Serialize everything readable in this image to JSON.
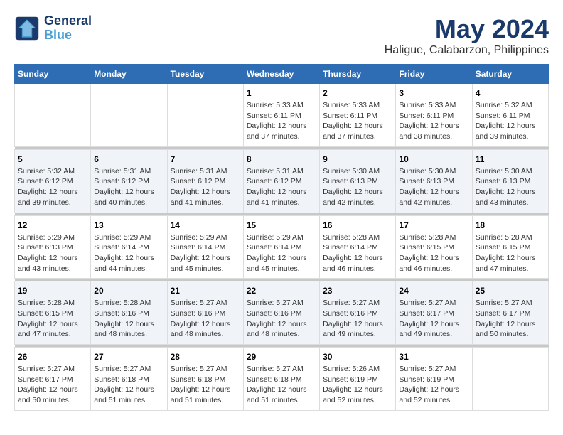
{
  "logo": {
    "line1": "General",
    "line2": "Blue"
  },
  "title": "May 2024",
  "subtitle": "Haligue, Calabarzon, Philippines",
  "headers": [
    "Sunday",
    "Monday",
    "Tuesday",
    "Wednesday",
    "Thursday",
    "Friday",
    "Saturday"
  ],
  "weeks": [
    {
      "days": [
        {
          "num": "",
          "info": ""
        },
        {
          "num": "",
          "info": ""
        },
        {
          "num": "",
          "info": ""
        },
        {
          "num": "1",
          "info": "Sunrise: 5:33 AM\nSunset: 6:11 PM\nDaylight: 12 hours\nand 37 minutes."
        },
        {
          "num": "2",
          "info": "Sunrise: 5:33 AM\nSunset: 6:11 PM\nDaylight: 12 hours\nand 37 minutes."
        },
        {
          "num": "3",
          "info": "Sunrise: 5:33 AM\nSunset: 6:11 PM\nDaylight: 12 hours\nand 38 minutes."
        },
        {
          "num": "4",
          "info": "Sunrise: 5:32 AM\nSunset: 6:11 PM\nDaylight: 12 hours\nand 39 minutes."
        }
      ]
    },
    {
      "days": [
        {
          "num": "5",
          "info": "Sunrise: 5:32 AM\nSunset: 6:12 PM\nDaylight: 12 hours\nand 39 minutes."
        },
        {
          "num": "6",
          "info": "Sunrise: 5:31 AM\nSunset: 6:12 PM\nDaylight: 12 hours\nand 40 minutes."
        },
        {
          "num": "7",
          "info": "Sunrise: 5:31 AM\nSunset: 6:12 PM\nDaylight: 12 hours\nand 41 minutes."
        },
        {
          "num": "8",
          "info": "Sunrise: 5:31 AM\nSunset: 6:12 PM\nDaylight: 12 hours\nand 41 minutes."
        },
        {
          "num": "9",
          "info": "Sunrise: 5:30 AM\nSunset: 6:13 PM\nDaylight: 12 hours\nand 42 minutes."
        },
        {
          "num": "10",
          "info": "Sunrise: 5:30 AM\nSunset: 6:13 PM\nDaylight: 12 hours\nand 42 minutes."
        },
        {
          "num": "11",
          "info": "Sunrise: 5:30 AM\nSunset: 6:13 PM\nDaylight: 12 hours\nand 43 minutes."
        }
      ]
    },
    {
      "days": [
        {
          "num": "12",
          "info": "Sunrise: 5:29 AM\nSunset: 6:13 PM\nDaylight: 12 hours\nand 43 minutes."
        },
        {
          "num": "13",
          "info": "Sunrise: 5:29 AM\nSunset: 6:14 PM\nDaylight: 12 hours\nand 44 minutes."
        },
        {
          "num": "14",
          "info": "Sunrise: 5:29 AM\nSunset: 6:14 PM\nDaylight: 12 hours\nand 45 minutes."
        },
        {
          "num": "15",
          "info": "Sunrise: 5:29 AM\nSunset: 6:14 PM\nDaylight: 12 hours\nand 45 minutes."
        },
        {
          "num": "16",
          "info": "Sunrise: 5:28 AM\nSunset: 6:14 PM\nDaylight: 12 hours\nand 46 minutes."
        },
        {
          "num": "17",
          "info": "Sunrise: 5:28 AM\nSunset: 6:15 PM\nDaylight: 12 hours\nand 46 minutes."
        },
        {
          "num": "18",
          "info": "Sunrise: 5:28 AM\nSunset: 6:15 PM\nDaylight: 12 hours\nand 47 minutes."
        }
      ]
    },
    {
      "days": [
        {
          "num": "19",
          "info": "Sunrise: 5:28 AM\nSunset: 6:15 PM\nDaylight: 12 hours\nand 47 minutes."
        },
        {
          "num": "20",
          "info": "Sunrise: 5:28 AM\nSunset: 6:16 PM\nDaylight: 12 hours\nand 48 minutes."
        },
        {
          "num": "21",
          "info": "Sunrise: 5:27 AM\nSunset: 6:16 PM\nDaylight: 12 hours\nand 48 minutes."
        },
        {
          "num": "22",
          "info": "Sunrise: 5:27 AM\nSunset: 6:16 PM\nDaylight: 12 hours\nand 48 minutes."
        },
        {
          "num": "23",
          "info": "Sunrise: 5:27 AM\nSunset: 6:16 PM\nDaylight: 12 hours\nand 49 minutes."
        },
        {
          "num": "24",
          "info": "Sunrise: 5:27 AM\nSunset: 6:17 PM\nDaylight: 12 hours\nand 49 minutes."
        },
        {
          "num": "25",
          "info": "Sunrise: 5:27 AM\nSunset: 6:17 PM\nDaylight: 12 hours\nand 50 minutes."
        }
      ]
    },
    {
      "days": [
        {
          "num": "26",
          "info": "Sunrise: 5:27 AM\nSunset: 6:17 PM\nDaylight: 12 hours\nand 50 minutes."
        },
        {
          "num": "27",
          "info": "Sunrise: 5:27 AM\nSunset: 6:18 PM\nDaylight: 12 hours\nand 51 minutes."
        },
        {
          "num": "28",
          "info": "Sunrise: 5:27 AM\nSunset: 6:18 PM\nDaylight: 12 hours\nand 51 minutes."
        },
        {
          "num": "29",
          "info": "Sunrise: 5:27 AM\nSunset: 6:18 PM\nDaylight: 12 hours\nand 51 minutes."
        },
        {
          "num": "30",
          "info": "Sunrise: 5:26 AM\nSunset: 6:19 PM\nDaylight: 12 hours\nand 52 minutes."
        },
        {
          "num": "31",
          "info": "Sunrise: 5:27 AM\nSunset: 6:19 PM\nDaylight: 12 hours\nand 52 minutes."
        },
        {
          "num": "",
          "info": ""
        }
      ]
    }
  ]
}
